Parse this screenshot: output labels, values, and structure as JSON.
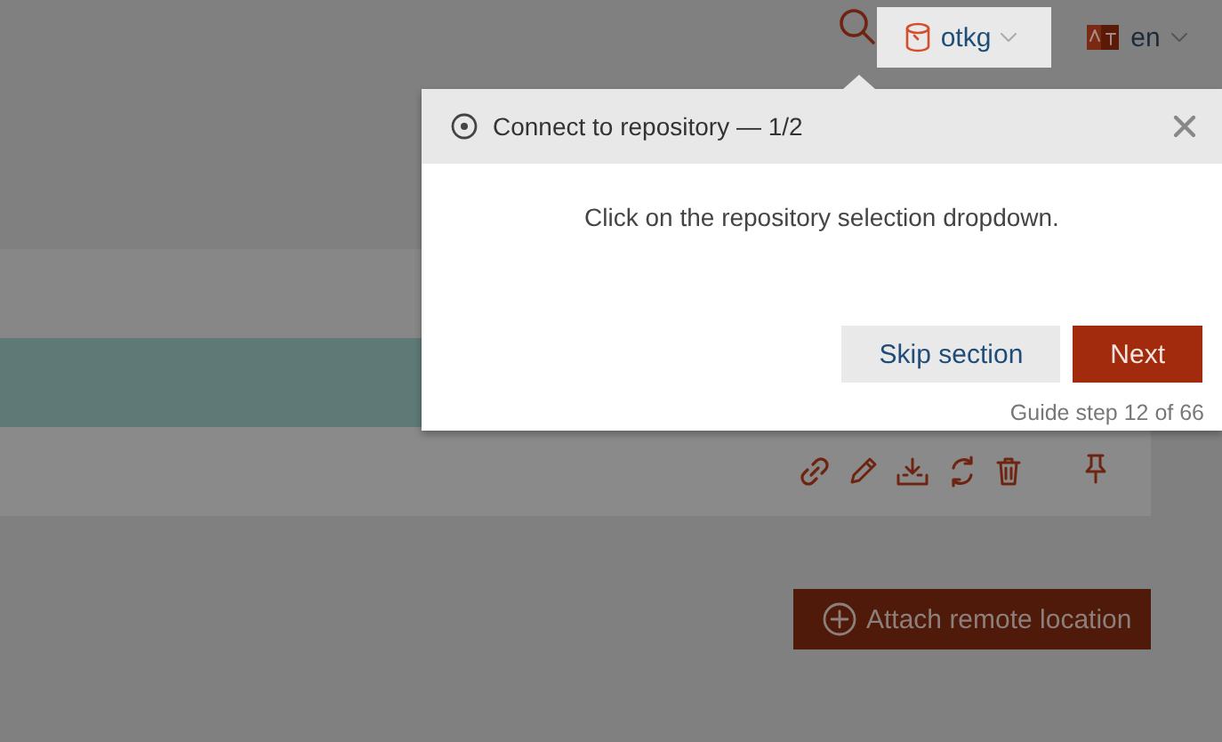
{
  "top_bar": {
    "repository_selector": {
      "label": "otkg",
      "highlighted": true
    },
    "language_selector": {
      "label": "en"
    }
  },
  "guide": {
    "title": "Connect to repository — 1/2",
    "message": "Click on the repository selection dropdown.",
    "buttons": [
      {
        "label": "Skip section",
        "kind": "secondary"
      },
      {
        "label": "Next",
        "kind": "primary"
      }
    ],
    "step": "Guide step 12 of 66"
  },
  "attach_button": {
    "label": "Attach remote location"
  }
}
